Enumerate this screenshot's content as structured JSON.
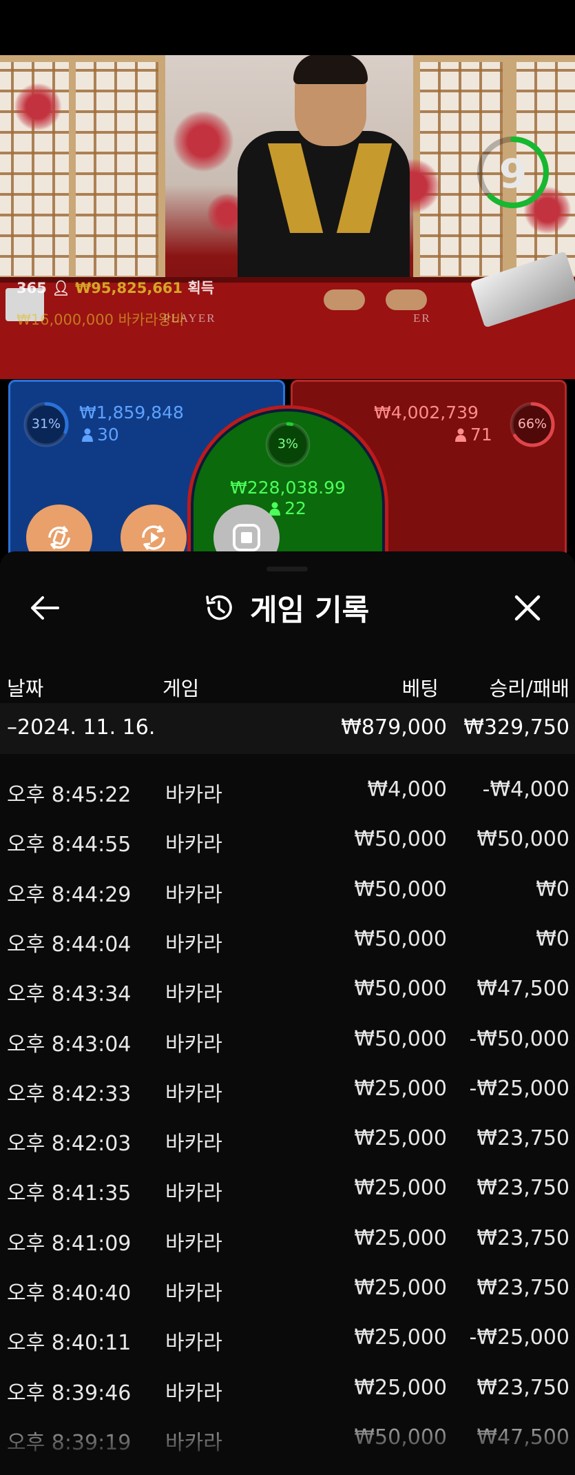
{
  "video": {
    "timer": "9",
    "timer_progress": 0.62,
    "player_count": "365",
    "winnings_amount": "₩95,825,661",
    "winnings_label": "획득",
    "ticker": "₩16,000,000 바카라왕바",
    "table_label_left": "PLAYER",
    "table_label_right": "ER"
  },
  "bets": {
    "player": {
      "percent_text": "31%",
      "percent": 31,
      "amount": "₩1,859,848",
      "count": "30",
      "color": "#2b72d8"
    },
    "tie": {
      "percent_text": "3%",
      "percent": 3,
      "amount": "₩228,038.99",
      "count": "22",
      "color": "#1fcf32"
    },
    "banker": {
      "percent_text": "66%",
      "percent": 66,
      "amount": "₩4,002,739",
      "count": "71",
      "color": "#e0454a"
    }
  },
  "actions": {
    "button1_icon": "rebet-icon",
    "button2_icon": "autoplay-icon",
    "button3_icon": "stop-icon"
  },
  "history": {
    "title": "게임 기록",
    "columns": {
      "date": "날짜",
      "game": "게임",
      "bet": "베팅",
      "result": "승리/패배"
    },
    "summary": {
      "date": "–2024. 11. 16.",
      "bet": "₩879,000",
      "result": "₩329,750"
    },
    "rows": [
      {
        "time": "오후 8:45:22",
        "game": "바카라",
        "bet": "₩4,000",
        "result": "-₩4,000"
      },
      {
        "time": "오후 8:44:55",
        "game": "바카라",
        "bet": "₩50,000",
        "result": "₩50,000"
      },
      {
        "time": "오후 8:44:29",
        "game": "바카라",
        "bet": "₩50,000",
        "result": "₩0"
      },
      {
        "time": "오후 8:44:04",
        "game": "바카라",
        "bet": "₩50,000",
        "result": "₩0"
      },
      {
        "time": "오후 8:43:34",
        "game": "바카라",
        "bet": "₩50,000",
        "result": "₩47,500"
      },
      {
        "time": "오후 8:43:04",
        "game": "바카라",
        "bet": "₩50,000",
        "result": "-₩50,000"
      },
      {
        "time": "오후 8:42:33",
        "game": "바카라",
        "bet": "₩25,000",
        "result": "-₩25,000"
      },
      {
        "time": "오후 8:42:03",
        "game": "바카라",
        "bet": "₩25,000",
        "result": "₩23,750"
      },
      {
        "time": "오후 8:41:35",
        "game": "바카라",
        "bet": "₩25,000",
        "result": "₩23,750"
      },
      {
        "time": "오후 8:41:09",
        "game": "바카라",
        "bet": "₩25,000",
        "result": "₩23,750"
      },
      {
        "time": "오후 8:40:40",
        "game": "바카라",
        "bet": "₩25,000",
        "result": "₩23,750"
      },
      {
        "time": "오후 8:40:11",
        "game": "바카라",
        "bet": "₩25,000",
        "result": "-₩25,000"
      },
      {
        "time": "오후 8:39:46",
        "game": "바카라",
        "bet": "₩25,000",
        "result": "₩23,750"
      },
      {
        "time": "오후 8:39:19",
        "game": "바카라",
        "bet": "₩50,000",
        "result": "₩47,500"
      }
    ]
  }
}
